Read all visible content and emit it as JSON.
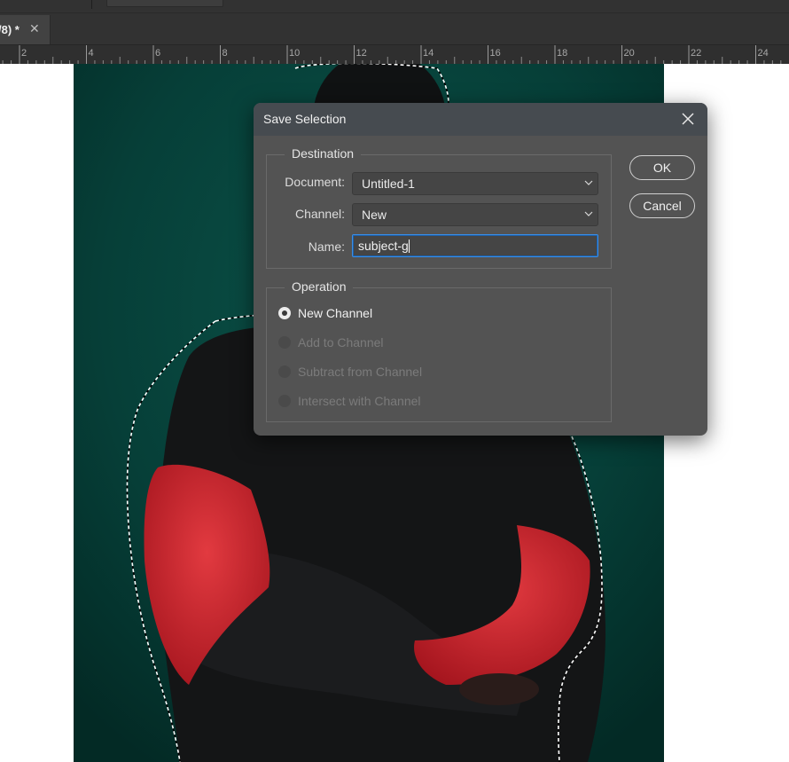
{
  "document_tab": {
    "title": "/8) *",
    "close_icon": "close-icon"
  },
  "ruler": {
    "labels": [
      "2",
      "4",
      "6",
      "8",
      "10",
      "12",
      "14",
      "16",
      "18",
      "20",
      "22",
      "24"
    ]
  },
  "dialog": {
    "title": "Save Selection",
    "close_icon": "close-icon",
    "destination": {
      "legend": "Destination",
      "document_label": "Document:",
      "document_value": "Untitled-1",
      "channel_label": "Channel:",
      "channel_value": "New",
      "name_label": "Name:",
      "name_value": "subject-g"
    },
    "operation": {
      "legend": "Operation",
      "options": [
        {
          "label": "New Channel",
          "selected": true,
          "enabled": true
        },
        {
          "label": "Add to Channel",
          "selected": false,
          "enabled": false
        },
        {
          "label": "Subtract from Channel",
          "selected": false,
          "enabled": false
        },
        {
          "label": "Intersect with Channel",
          "selected": false,
          "enabled": false
        }
      ]
    },
    "ok_label": "OK",
    "cancel_label": "Cancel"
  },
  "colors": {
    "photo_background": "#063f38",
    "sweater": "#141516",
    "fur": "#c4202a",
    "dialog_bg": "#535353",
    "focus_blue": "#3a8ee6"
  }
}
